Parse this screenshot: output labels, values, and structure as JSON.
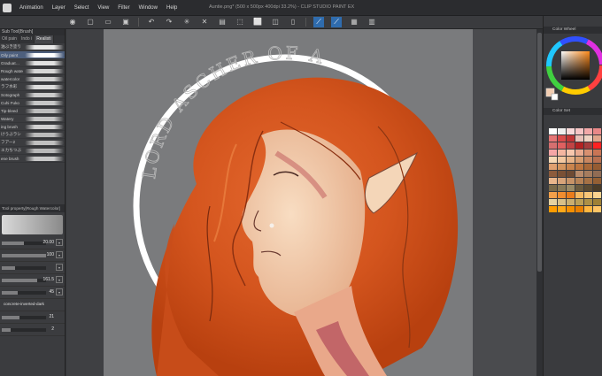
{
  "window": {
    "title": "Auntie.png* (500 x 500px 400dpi 33.2%) - CLIP STUDIO PAINT EX",
    "menu": [
      "Animation",
      "Layer",
      "Select",
      "View",
      "Filter",
      "Window",
      "Help"
    ]
  },
  "command_bar": {
    "buttons": [
      {
        "name": "clip-studio-icon",
        "glyph": "◉"
      },
      {
        "name": "new-icon",
        "glyph": "▢"
      },
      {
        "name": "open-icon",
        "glyph": "▭"
      },
      {
        "name": "save-icon",
        "glyph": "▣"
      },
      {
        "name": "undo-icon",
        "glyph": "↶"
      },
      {
        "name": "redo-icon",
        "glyph": "↷"
      },
      {
        "name": "loading-icon",
        "glyph": "✳"
      },
      {
        "name": "clear-icon",
        "glyph": "✕"
      },
      {
        "name": "fill-icon",
        "glyph": "▤"
      },
      {
        "name": "transform-icon",
        "glyph": "⬚"
      },
      {
        "name": "deselect-icon",
        "glyph": "⬜"
      },
      {
        "name": "crop-icon",
        "glyph": "◫"
      },
      {
        "name": "show-border-icon",
        "glyph": "▯"
      },
      {
        "name": "snap-ruler-icon",
        "glyph": "⟋",
        "active": true
      },
      {
        "name": "snap-special-ruler-icon",
        "glyph": "⟋",
        "active": true
      },
      {
        "name": "snap-grid-icon",
        "glyph": "▦"
      },
      {
        "name": "settings-icon",
        "glyph": "▥"
      }
    ]
  },
  "left_panel": {
    "header": "Sub Tool[Brush]",
    "tabs": [
      "Oil pain",
      "Indo i",
      "Realisti"
    ],
    "brushes": [
      {
        "label": "油ぶき塗り",
        "stroke": "#e7e7e7"
      },
      {
        "label": "Oily paint",
        "stroke": "#ffffff",
        "selected": true
      },
      {
        "label": "Graduat…",
        "stroke": "#e2e2e2"
      },
      {
        "label": "Rough watercolor",
        "stroke": "#d6d6d6"
      },
      {
        "label": "watercolor",
        "stroke": "#cfcfcf"
      },
      {
        "label": "ラフ水彩",
        "stroke": "#dcdcdc"
      },
      {
        "label": "Sotograph",
        "stroke": "#cccccc"
      },
      {
        "label": "Cuhi Fuko",
        "stroke": "#c7c7c7"
      },
      {
        "label": "Tip-bleed",
        "stroke": "#bdbdbd"
      },
      {
        "label": "Watery",
        "stroke": "#c4c4c4"
      },
      {
        "label": "ing brush",
        "stroke": "#d0d0d0"
      },
      {
        "label": "けうぶラシ",
        "stroke": "#bbbbbb"
      },
      {
        "label": "フアー2",
        "stroke": "#c0c0c0"
      },
      {
        "label": "エカちつぶ",
        "stroke": "#b9b9b9"
      },
      {
        "label": "ene brush",
        "stroke": "#cacaca"
      }
    ],
    "tool_property_header": "Tool property[Rough Watercolor]",
    "properties": [
      {
        "value": "20.00",
        "fill": 0.5
      },
      {
        "value": "100",
        "fill": 1.0
      },
      {
        "value": "",
        "fill": 0.3
      },
      {
        "value": "161.5",
        "fill": 0.8
      },
      {
        "value": "45",
        "fill": 0.35
      }
    ],
    "texture_name": "concrete-inverted-dark",
    "texture_values": [
      "21",
      "2"
    ]
  },
  "right_panel": {
    "color_wheel_title": "Color Wheel",
    "color_set_title": "Color Set",
    "main_color": "#f2cdb1",
    "swatches": [
      "#ffffff",
      "#eeeeee",
      "#f8d9d9",
      "#f6c5c5",
      "#f2a8a8",
      "#e98888",
      "#e57575",
      "#d94b4b",
      "#c13535",
      "#e8c1b8",
      "#efd3c3",
      "#e2a48b",
      "#d66f6f",
      "#e06060",
      "#c14444",
      "#b22222",
      "#a63b3b",
      "#ff2222",
      "#f6a6a6",
      "#f4b6a0",
      "#f7c7ad",
      "#e9aa8f",
      "#d89070",
      "#c97555",
      "#f7d8b4",
      "#f3c8a0",
      "#e8b488",
      "#d89d70",
      "#c88660",
      "#b87050",
      "#e0a070",
      "#d4955f",
      "#c9844d",
      "#be7640",
      "#a86838",
      "#955c32",
      "#8c5b3c",
      "#7a5035",
      "#6e4a33",
      "#b88a6a",
      "#a57c5e",
      "#906c54",
      "#e9b68c",
      "#d8a47a",
      "#c79368",
      "#b68256",
      "#a57145",
      "#946034",
      "#7a6a4a",
      "#8a7a58",
      "#9a8a66",
      "#6a5a3e",
      "#5a4a32",
      "#4a3c28",
      "#f3a04a",
      "#f08d30",
      "#e97c1c",
      "#f5b860",
      "#f8c678",
      "#fbd38f",
      "#e6d2a0",
      "#d8c088",
      "#c9ae70",
      "#bba058",
      "#ad9046",
      "#9e8036",
      "#ff9c00",
      "#ffa81a",
      "#f58f00",
      "#e87f00",
      "#ffb640",
      "#ffc566"
    ]
  },
  "artwork": {
    "caption": "LORD ASCHER OF AUN"
  }
}
